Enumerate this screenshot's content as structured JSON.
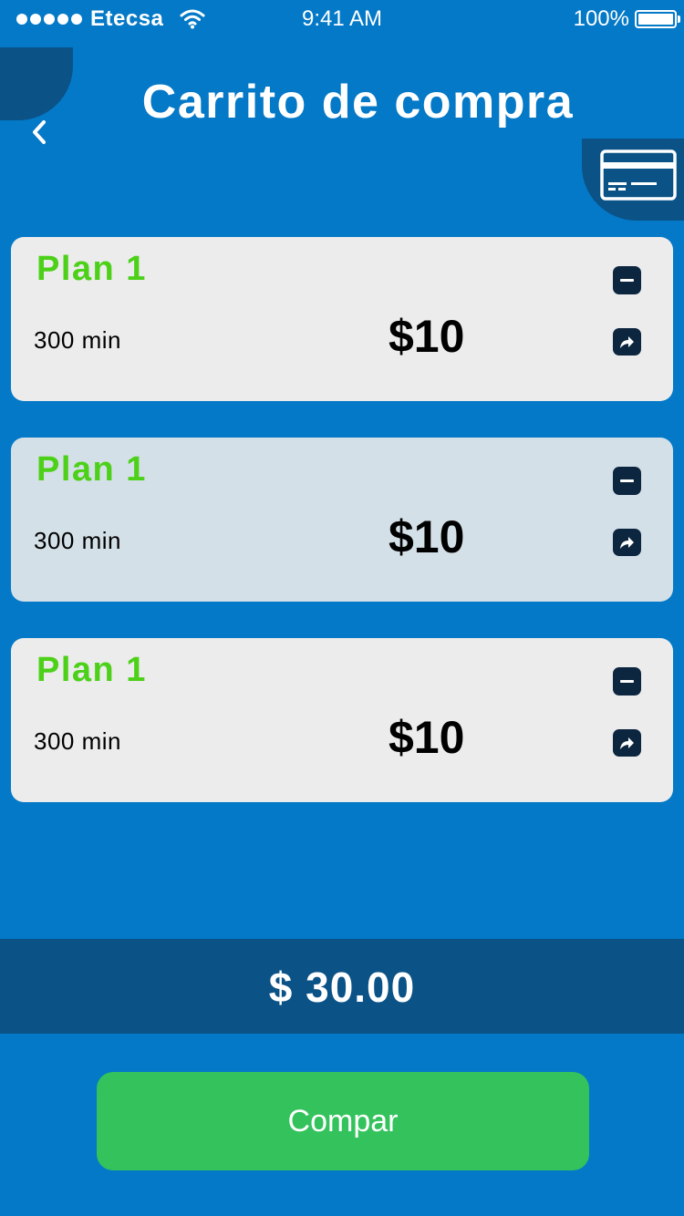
{
  "status_bar": {
    "carrier": "Etecsa",
    "time": "9:41 AM",
    "battery": "100%",
    "icons": [
      "signal-dots-icon",
      "wifi-icon",
      "battery-icon"
    ]
  },
  "header": {
    "title": "Carrito de compra",
    "back_icon": "chevron-left-icon",
    "card_icon": "credit-card-icon"
  },
  "cart": {
    "items": [
      {
        "name": "Plan 1",
        "minutes": "300 min",
        "price": "$10"
      },
      {
        "name": "Plan 1",
        "minutes": "300 min",
        "price": "$10"
      },
      {
        "name": "Plan 1",
        "minutes": "300 min",
        "price": "$10"
      }
    ],
    "item_icons": [
      "minus-icon",
      "share-arrow-icon"
    ]
  },
  "total": {
    "value": "$ 30.00"
  },
  "actions": {
    "buy_label": "Compar"
  },
  "colors": {
    "background": "#0479C7",
    "dark_accent": "#0B5287",
    "plan_name": "#4CD118",
    "buy_button": "#33C25C",
    "icon_button": "#0D2640"
  }
}
